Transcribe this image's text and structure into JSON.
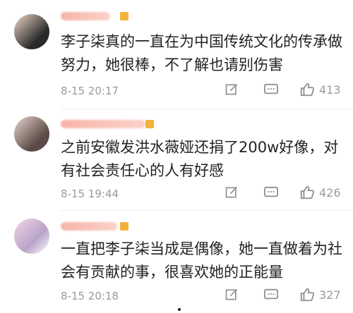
{
  "comments": [
    {
      "text": "李子柒真的一直在为中国传统文化的传承做努力，她很棒，不了解也请别伤害",
      "time": "8-15 20:17",
      "likes": "413"
    },
    {
      "text": "之前安徽发洪水薇娅还捐了200w好像，对有社会责任心的人有好感",
      "time": "8-15 19:44",
      "likes": "426"
    },
    {
      "text": "一直把李子柒当成是偶像，她一直做着为社会有贡献的事，很喜欢她的正能量",
      "time": "8-15 20:18",
      "likes": "327"
    }
  ],
  "icons": {
    "repost": "share-edit-icon",
    "reply": "comment-icon",
    "like": "thumbs-up-icon"
  }
}
